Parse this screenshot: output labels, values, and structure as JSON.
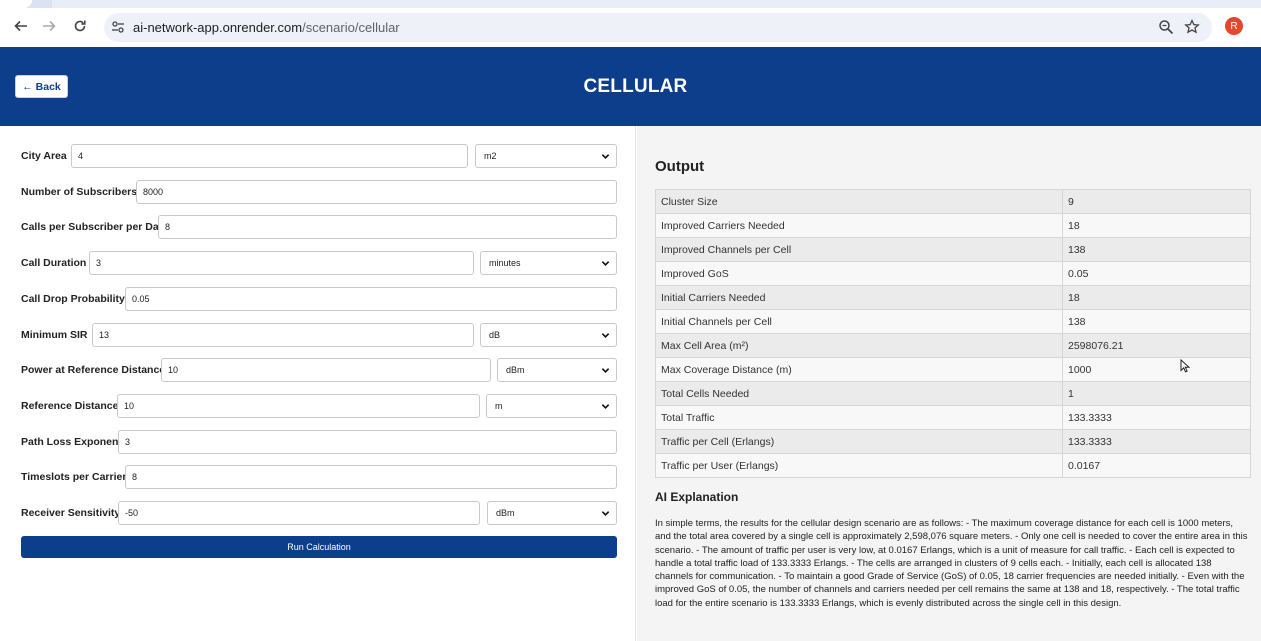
{
  "browser": {
    "url_host": "ai-network-app.onrender.com",
    "url_path": "/scenario/cellular",
    "avatar_letter": "R",
    "avatar_color": "#e8452c"
  },
  "header": {
    "back_label": "← Back",
    "title": "CELLULAR",
    "bg_color": "#0d3e8c"
  },
  "form": {
    "fields": [
      {
        "label": "City Area",
        "value": "4",
        "unit": "m2"
      },
      {
        "label": "Number of Subscribers",
        "value": "8000"
      },
      {
        "label": "Calls per Subscriber per Day",
        "value": "8"
      },
      {
        "label": "Call Duration",
        "value": "3",
        "unit": "minutes"
      },
      {
        "label": "Call Drop Probability",
        "value": "0.05"
      },
      {
        "label": "Minimum SIR",
        "value": "13",
        "unit": "dB"
      },
      {
        "label": "Power at Reference Distance",
        "value": "10",
        "unit": "dBm"
      },
      {
        "label": "Reference Distance",
        "value": "10",
        "unit": "m"
      },
      {
        "label": "Path Loss Exponent",
        "value": "3"
      },
      {
        "label": "Timeslots per Carrier",
        "value": "8"
      },
      {
        "label": "Receiver Sensitivity",
        "value": "-50",
        "unit": "dBm"
      }
    ],
    "run_label": "Run Calculation"
  },
  "output": {
    "title": "Output",
    "rows": [
      {
        "key": "Cluster Size",
        "value": "9"
      },
      {
        "key": "Improved Carriers Needed",
        "value": "18"
      },
      {
        "key": "Improved Channels per Cell",
        "value": "138"
      },
      {
        "key": "Improved GoS",
        "value": "0.05"
      },
      {
        "key": "Initial Carriers Needed",
        "value": "18"
      },
      {
        "key": "Initial Channels per Cell",
        "value": "138"
      },
      {
        "key": "Max Cell Area (m²)",
        "value": "2598076.21"
      },
      {
        "key": "Max Coverage Distance (m)",
        "value": "1000"
      },
      {
        "key": "Total Cells Needed",
        "value": "1"
      },
      {
        "key": "Total Traffic",
        "value": "133.3333"
      },
      {
        "key": "Traffic per Cell (Erlangs)",
        "value": "133.3333"
      },
      {
        "key": "Traffic per User (Erlangs)",
        "value": "0.0167"
      }
    ]
  },
  "ai": {
    "title": "AI Explanation",
    "text": "In simple terms, the results for the cellular design scenario are as follows: - The maximum coverage distance for each cell is 1000 meters, and the total area covered by a single cell is approximately 2,598,076 square meters. - Only one cell is needed to cover the entire area in this scenario. - The amount of traffic per user is very low, at 0.0167 Erlangs, which is a unit of measure for call traffic. - Each cell is expected to handle a total traffic load of 133.3333 Erlangs. - The cells are arranged in clusters of 9 cells each. - Initially, each cell is allocated 138 channels for communication. - To maintain a good Grade of Service (GoS) of 0.05, 18 carrier frequencies are needed initially. - Even with the improved GoS of 0.05, the number of channels and carriers needed per cell remains the same at 138 and 18, respectively. - The total traffic load for the entire scenario is 133.3333 Erlangs, which is evenly distributed across the single cell in this design."
  }
}
